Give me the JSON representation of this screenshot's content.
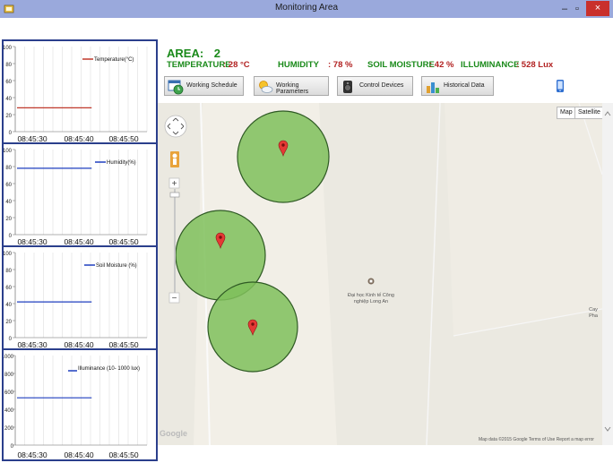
{
  "window": {
    "title": "Monitoring Area",
    "minimize_glyph": "–",
    "maximize_glyph": "▫",
    "close_glyph": "×"
  },
  "charts": [
    {
      "legend": "Temperature(°C)",
      "y_ticks": [
        "100",
        "80",
        "60",
        "40",
        "20",
        "0"
      ],
      "x_ticks": [
        "08:45:30",
        "08:45:40",
        "08:45:50"
      ],
      "series_color": "#c0392b",
      "value": 28,
      "ymax": 100
    },
    {
      "legend": "Humidity(%)",
      "y_ticks": [
        "100",
        "80",
        "60",
        "40",
        "20",
        "0"
      ],
      "x_ticks": [
        "08:45:30",
        "08:45:40",
        "08:45:50"
      ],
      "series_color": "#1f3fbf",
      "value": 78,
      "ymax": 100
    },
    {
      "legend": "Soil Moisture (%)",
      "y_ticks": [
        "100",
        "80",
        "60",
        "40",
        "20",
        "0"
      ],
      "x_ticks": [
        "08:45:30",
        "08:45:40",
        "08:45:50"
      ],
      "series_color": "#1f3fbf",
      "value": 42,
      "ymax": 100
    },
    {
      "legend": "Illuminance (10- 1000 lux)",
      "y_ticks": [
        "1000",
        "800",
        "600",
        "400",
        "200",
        "0"
      ],
      "x_ticks": [
        "08:45:30",
        "08:45:40",
        "08:45:50"
      ],
      "series_color": "#1f3fbf",
      "value": 528,
      "ymax": 1000
    }
  ],
  "area": {
    "label": "AREA:",
    "value": "2"
  },
  "sensors": {
    "temperature_label": "TEMPERATURE",
    "temperature_value": ": 28 °C",
    "humidity_label": "HUMIDITY",
    "humidity_value": ": 78 %",
    "soil_label": "SOIL MOISTURE",
    "soil_value": ": 42 %",
    "illum_label": "ILLUMINANCE",
    "illum_value": ": 528 Lux"
  },
  "buttons": {
    "schedule": "Working Schedule",
    "parameters": "Working Parameters",
    "devices": "Control Devices",
    "history": "Historical Data"
  },
  "map": {
    "type_map": "Map",
    "type_satellite": "Satellite",
    "zoom_in": "+",
    "zoom_out": "−",
    "place_label_line1": "Đại học Kinh tế Công",
    "place_label_line2": "nghiệp Long An",
    "edge_label_1": "Cay",
    "edge_label_2": "Pha",
    "google_logo": "Google",
    "attribution": "Map data ©2015 Google   Terms of Use   Report a map error",
    "zone_fill": "#7fbf5a",
    "marker_color": "#e53935"
  }
}
